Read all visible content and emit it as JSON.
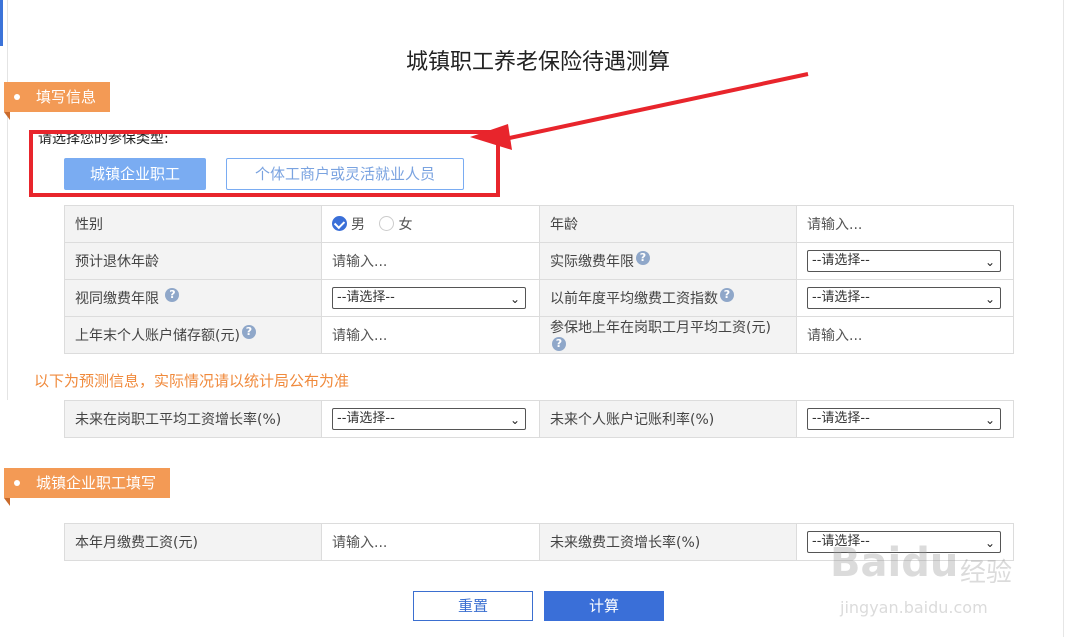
{
  "page": {
    "title": "城镇职工养老保险待遇测算"
  },
  "sections": {
    "fill_info": "填写信息",
    "urban_fill": "城镇企业职工填写"
  },
  "insurance_type": {
    "prompt": "请选择您的参保类型:",
    "options": [
      "城镇企业职工",
      "个体工商户或灵活就业人员"
    ],
    "selected": "城镇企业职工"
  },
  "basic_table": {
    "gender_label": "性别",
    "gender_male": "男",
    "gender_female": "女",
    "age_label": "年龄",
    "age_placeholder": "请输入...",
    "retire_age_label": "预计退休年龄",
    "retire_age_placeholder": "请输入...",
    "actual_years_label": "实际缴费年限",
    "actual_years_value": "--请选择--",
    "deemed_years_label": "视同缴费年限",
    "deemed_years_value": "--请选择--",
    "avg_index_label": "以前年度平均缴费工资指数",
    "avg_index_value": "--请选择--",
    "account_balance_label": "上年末个人账户储存额(元)",
    "account_balance_placeholder": "请输入...",
    "avg_wage_label": "参保地上年在岗职工月平均工资(元)",
    "avg_wage_placeholder": "请输入..."
  },
  "forecast_notice": "以下为预测信息，实际情况请以统计局公布为准",
  "forecast_table": {
    "wage_growth_label": "未来在岗职工平均工资增长率(%)",
    "wage_growth_value": "--请选择--",
    "account_rate_label": "未来个人账户记账利率(%)",
    "account_rate_value": "--请选择--"
  },
  "urban_table": {
    "monthly_wage_label": "本年月缴费工资(元)",
    "monthly_wage_placeholder": "请输入...",
    "future_growth_label": "未来缴费工资增长率(%)",
    "future_growth_value": "--请选择--"
  },
  "actions": {
    "reset": "重置",
    "calculate": "计算"
  },
  "watermark": {
    "brand": "Baidu",
    "cn": "经验",
    "url": "jingyan.baidu.com"
  },
  "colors": {
    "accent_blue": "#3a6fd8",
    "section_orange": "#f39a55",
    "notice_orange": "#f08a3c",
    "annotation_red": "#e8252c"
  }
}
